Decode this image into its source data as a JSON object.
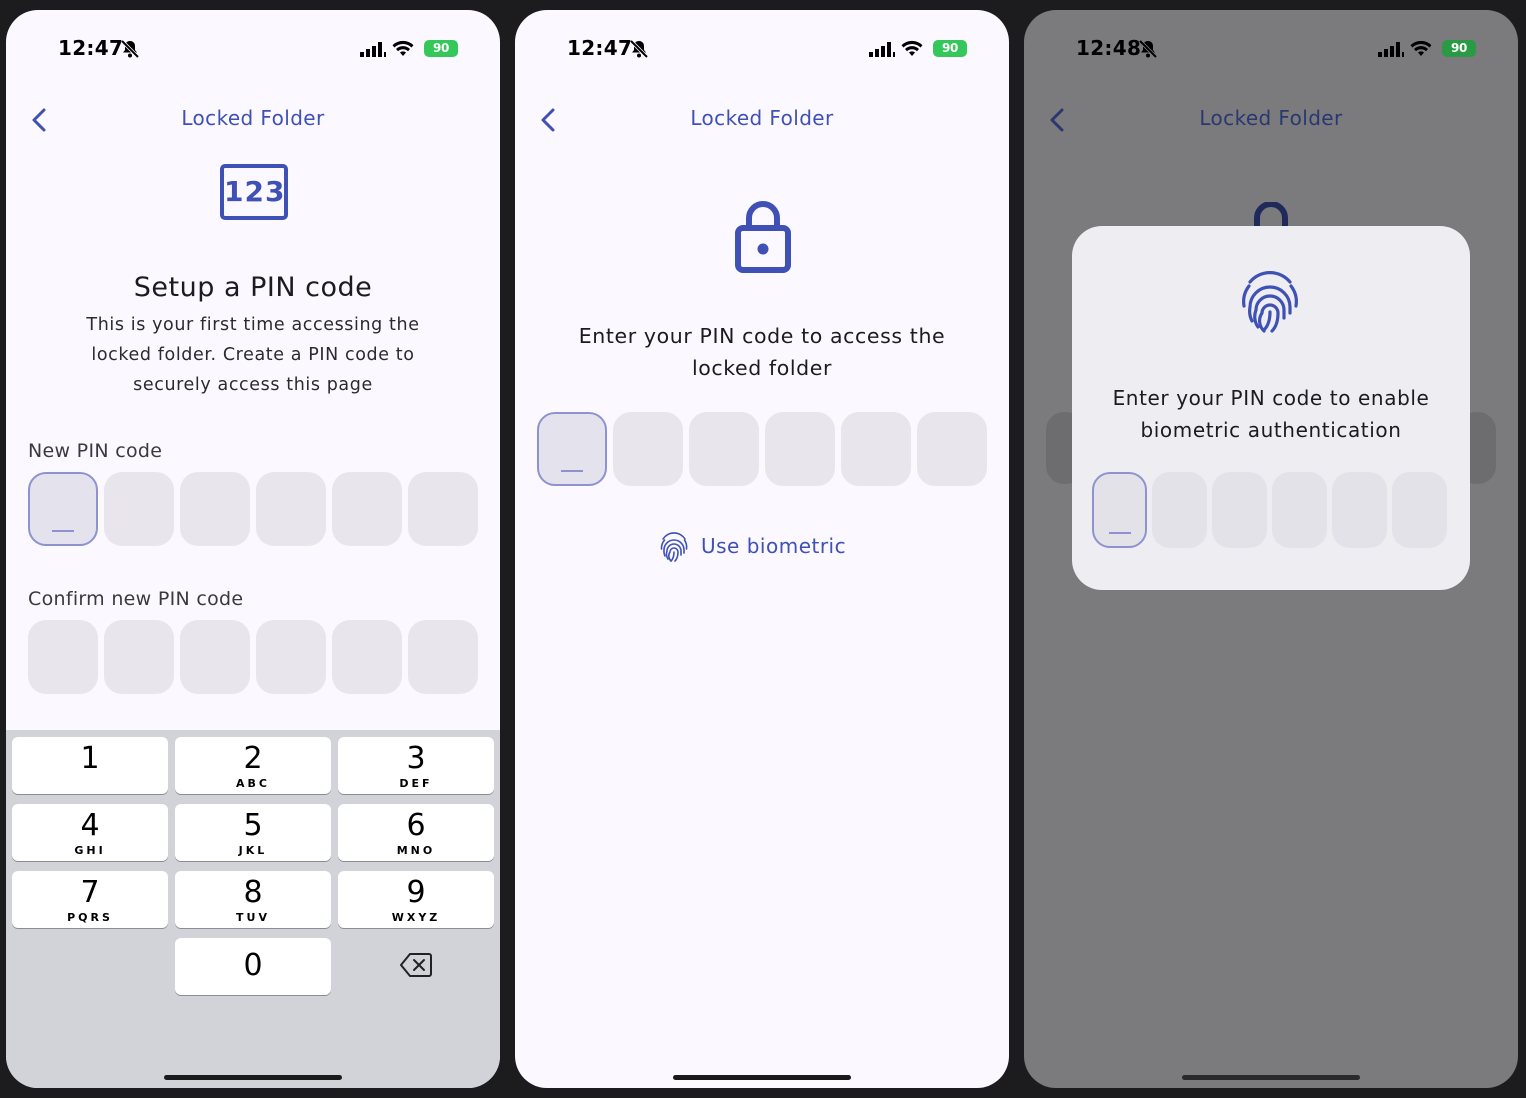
{
  "screens": [
    {
      "status": {
        "time": "12:47",
        "battery": "90"
      },
      "title": "Locked Folder",
      "icon_text": "123",
      "heading": "Setup a PIN code",
      "description": "This is your first time accessing the locked folder. Create a PIN code to securely access this page",
      "new_pin_label": "New PIN code",
      "confirm_pin_label": "Confirm new PIN code",
      "keypad": [
        {
          "num": "1",
          "letters": ""
        },
        {
          "num": "2",
          "letters": "ABC"
        },
        {
          "num": "3",
          "letters": "DEF"
        },
        {
          "num": "4",
          "letters": "GHI"
        },
        {
          "num": "5",
          "letters": "JKL"
        },
        {
          "num": "6",
          "letters": "MNO"
        },
        {
          "num": "7",
          "letters": "PQRS"
        },
        {
          "num": "8",
          "letters": "TUV"
        },
        {
          "num": "9",
          "letters": "WXYZ"
        },
        {
          "num": "0",
          "letters": ""
        }
      ]
    },
    {
      "status": {
        "time": "12:47",
        "battery": "90"
      },
      "title": "Locked Folder",
      "prompt": "Enter your PIN code to access the locked folder",
      "biometric_label": "Use biometric"
    },
    {
      "status": {
        "time": "12:48",
        "battery": "90"
      },
      "title": "Locked Folder",
      "dialog_text": "Enter your PIN code to enable biometric authentication"
    }
  ],
  "colors": {
    "accent": "#3f51b5",
    "battery": "#34c759",
    "pin_active_border": "#8e93d0"
  },
  "icons": [
    "chevron-left-icon",
    "bell-slash-icon",
    "signal-icon",
    "wifi-icon",
    "battery-icon",
    "pin-123-icon",
    "lock-icon",
    "fingerprint-icon",
    "backspace-icon"
  ]
}
